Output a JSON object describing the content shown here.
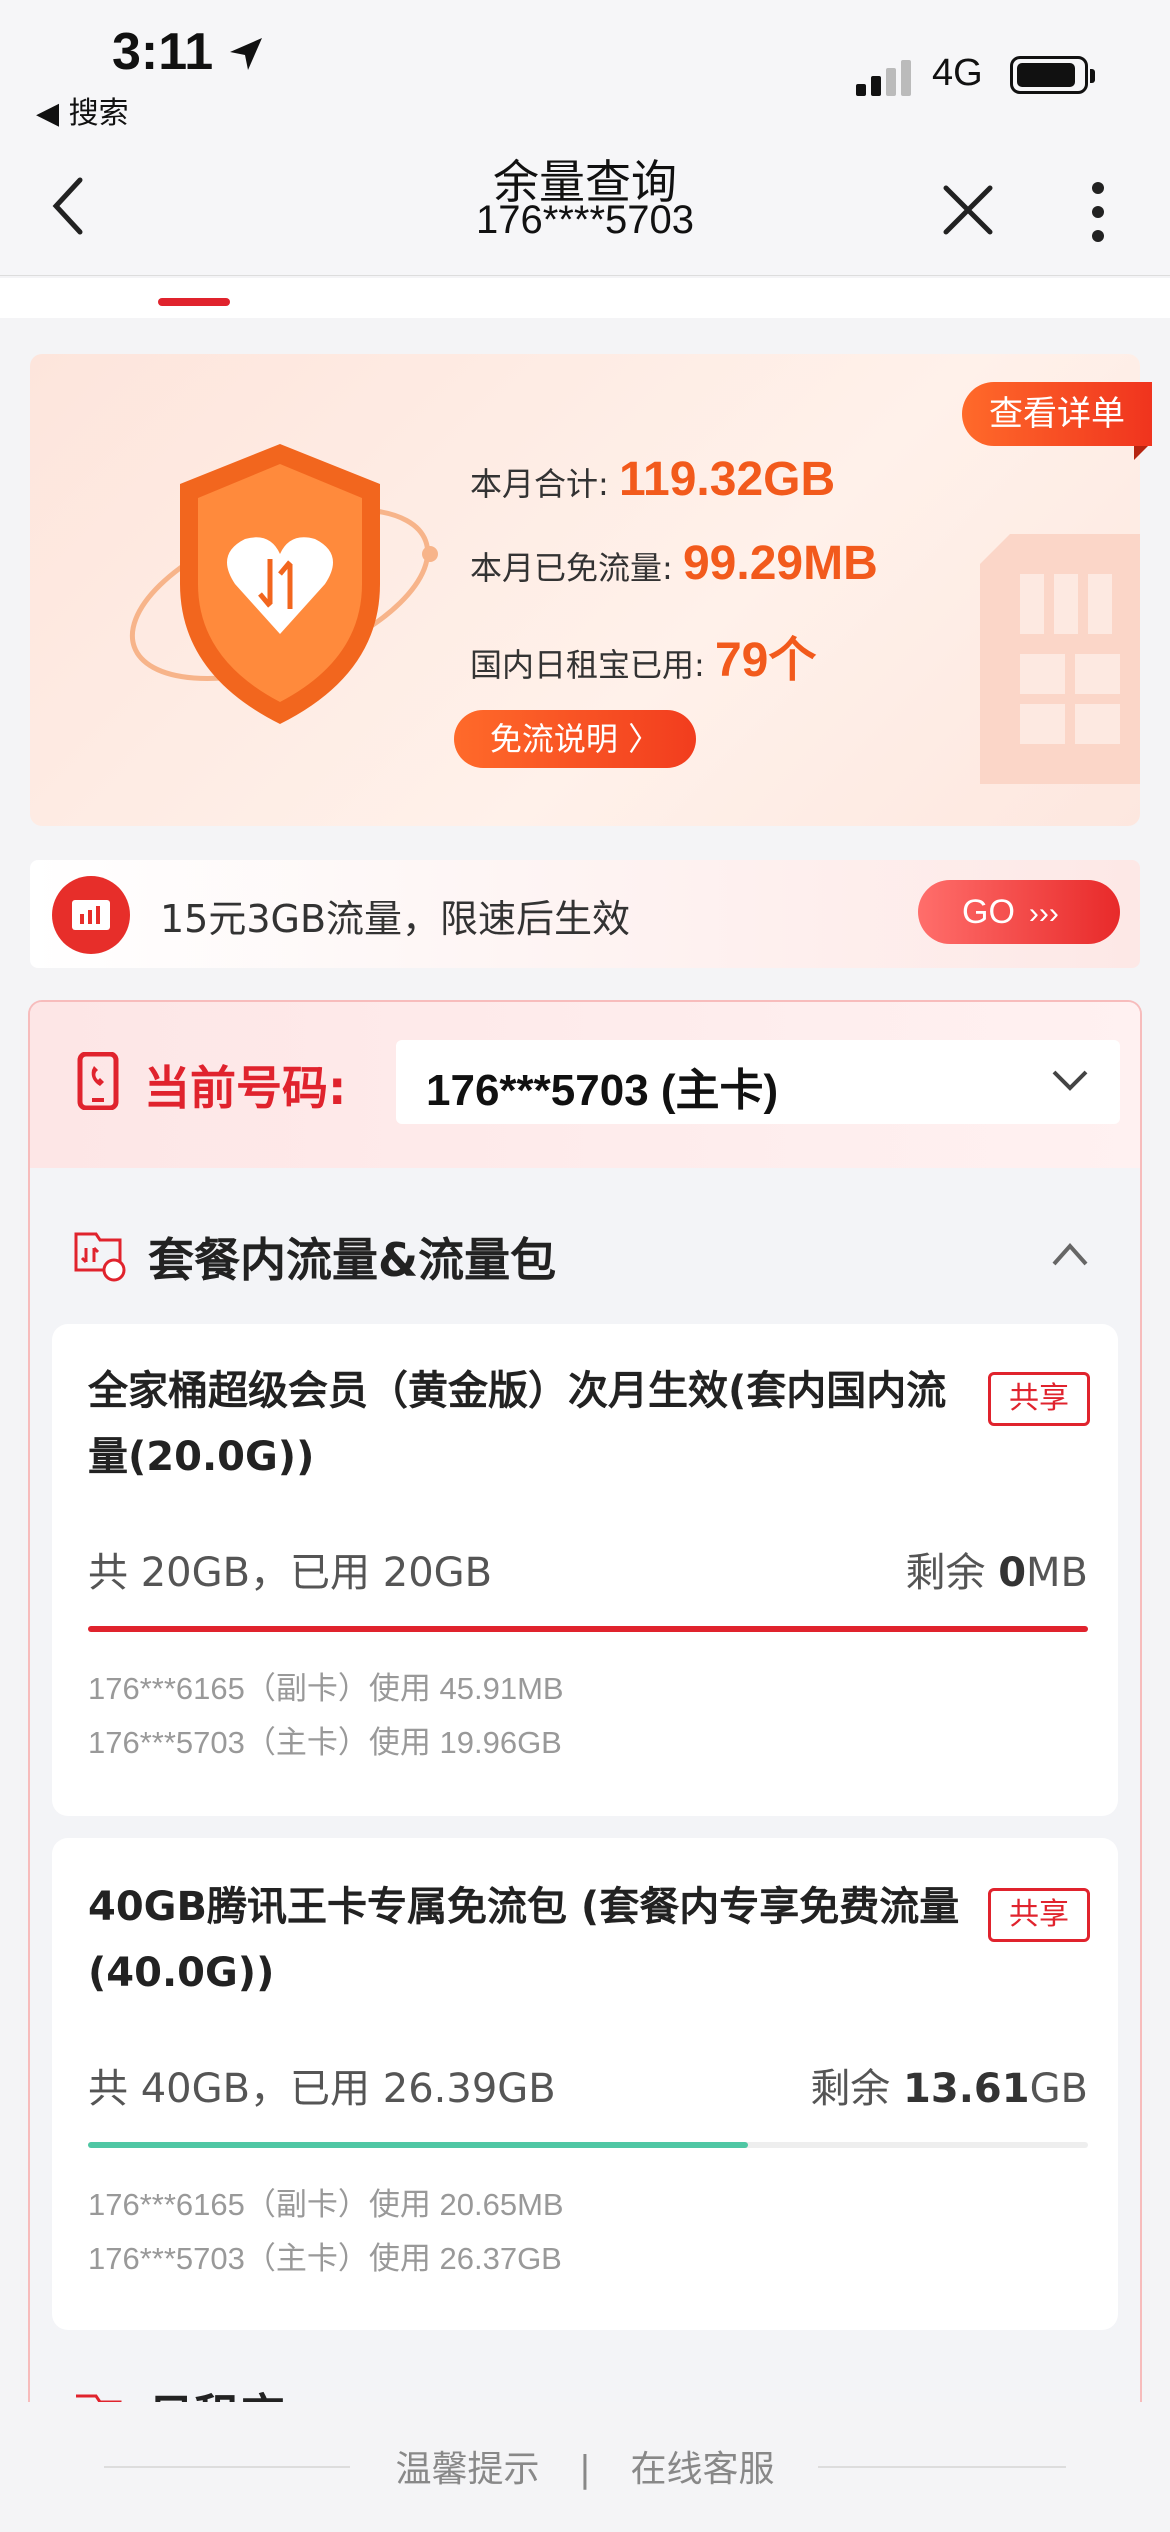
{
  "status_bar": {
    "time": "3:11",
    "back_label": "◀ 搜索",
    "network": "4G"
  },
  "nav": {
    "title": "余量查询",
    "subtitle": "176****5703"
  },
  "summary": {
    "detail_button": "查看详单",
    "total_label": "本月合计:",
    "total_value": "119.32GB",
    "free_label": "本月已免流量:",
    "free_value": "99.29MB",
    "daily_label": "国内日租宝已用:",
    "daily_value": "79个",
    "explain_button": "免流说明 〉"
  },
  "promo": {
    "text": "15元3GB流量，限速后生效",
    "button": "GO"
  },
  "current_number": {
    "label": "当前号码:",
    "value": "176***5703 (主卡)"
  },
  "section": {
    "title": "套餐内流量&流量包"
  },
  "packages": [
    {
      "title": "全家桶超级会员（黄金版）次月生效(套内国内流量(20.0G))",
      "badge": "共享",
      "usage": "共 20GB，已用 20GB",
      "remain_label": "剩余 ",
      "remain_value": "0",
      "remain_unit": "MB",
      "used_fraction": 1.0,
      "bar_color": "#e0232d",
      "members": [
        "176***6165（副卡）使用 45.91MB",
        "176***5703（主卡）使用 19.96GB"
      ]
    },
    {
      "title": "40GB腾讯王卡专属免流包 (套餐内专享免费流量(40.0G))",
      "badge": "共享",
      "usage": "共 40GB，已用 26.39GB",
      "remain_label": "剩余 ",
      "remain_value": "13.61",
      "remain_unit": "GB",
      "used_fraction": 0.66,
      "bar_color": "#4fc7a4",
      "members": [
        "176***6165（副卡）使用 20.65MB",
        "176***5703（主卡）使用 26.37GB"
      ]
    }
  ],
  "partial_section": {
    "title": "日租宝"
  },
  "footer": {
    "tips": "温馨提示",
    "separator": "|",
    "service": "在线客服"
  },
  "colors": {
    "brand_red": "#e0232d",
    "accent_orange": "#f25a1c",
    "teal": "#4fc7a4"
  }
}
